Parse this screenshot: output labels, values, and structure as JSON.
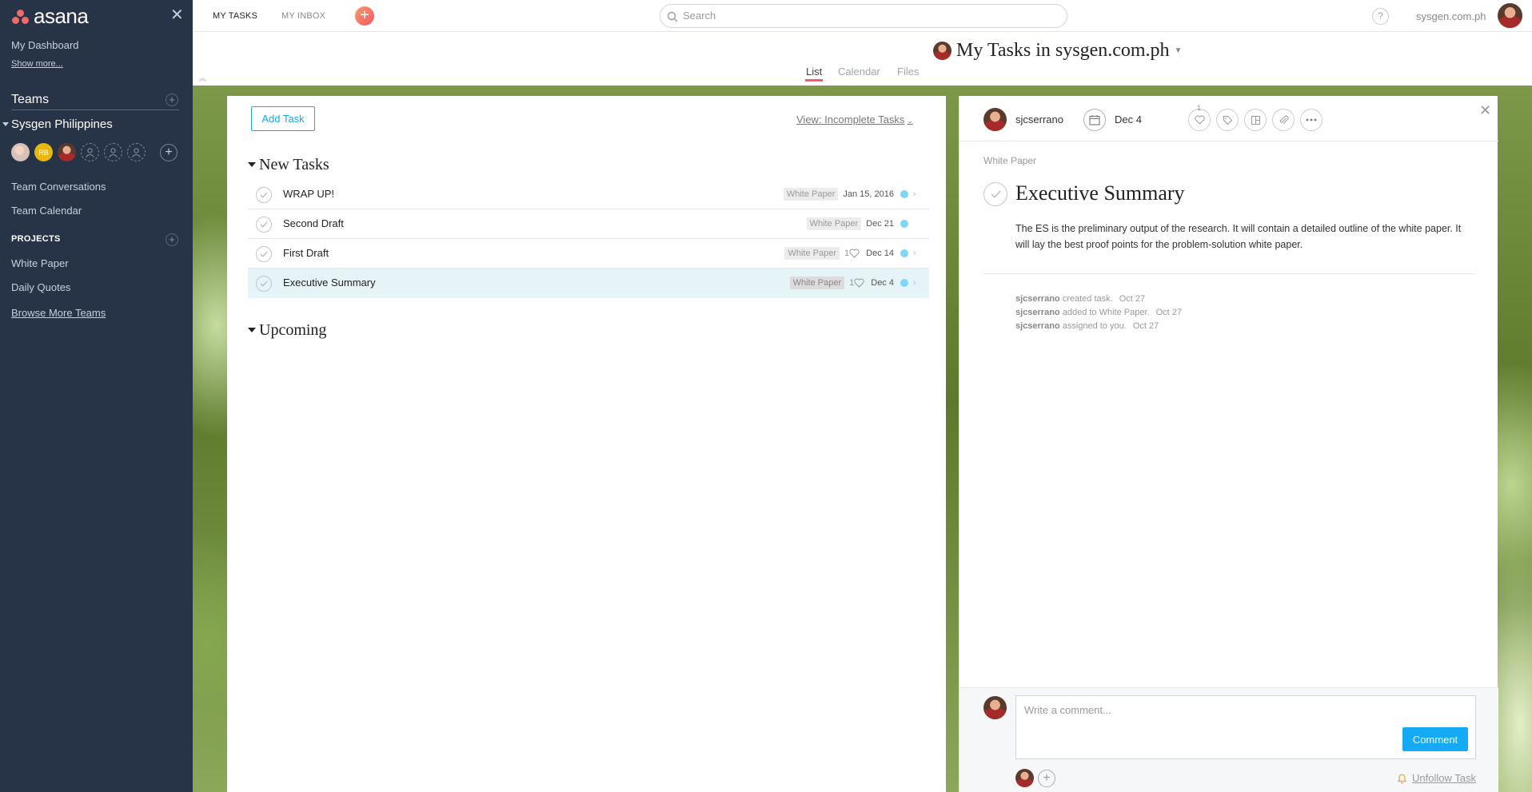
{
  "app": {
    "logo_text": "asana"
  },
  "sidebar": {
    "close_glyph": "✕",
    "dashboard_label": "My Dashboard",
    "show_more_label": "Show more...",
    "teams_label": "Teams",
    "team_name": "Sysgen Philippines",
    "member_initials": "RB",
    "team_conversations_label": "Team Conversations",
    "team_calendar_label": "Team Calendar",
    "projects_label": "PROJECTS",
    "projects": [
      {
        "label": "White Paper"
      },
      {
        "label": "Daily Quotes"
      }
    ],
    "browse_more_label": "Browse More Teams"
  },
  "topbar": {
    "my_tasks_label": "MY TASKS",
    "my_inbox_label": "MY INBOX",
    "search_placeholder": "Search",
    "help_label": "?",
    "workspace_name": "sysgen.com.ph"
  },
  "titlebar": {
    "title": "My Tasks in sysgen.com.ph",
    "views": [
      "List",
      "Calendar",
      "Files"
    ]
  },
  "list": {
    "add_task_label": "Add Task",
    "view_filter_label": "View: Incomplete Tasks",
    "sections": [
      {
        "name": "New Tasks",
        "tasks": [
          {
            "name": "WRAP UP!",
            "tag": "White Paper",
            "likes": "",
            "date": "Jan 15, 2016"
          },
          {
            "name": "Second Draft",
            "tag": "White Paper",
            "likes": "",
            "date": "Dec 21"
          },
          {
            "name": "First Draft",
            "tag": "White Paper",
            "likes": "1",
            "date": "Dec 14"
          },
          {
            "name": "Executive Summary",
            "tag": "White Paper",
            "likes": "1",
            "date": "Dec 4"
          }
        ]
      },
      {
        "name": "Upcoming",
        "tasks": []
      }
    ]
  },
  "detail": {
    "assignee": "sjcserrano",
    "due_date": "Dec 4",
    "like_count": "1",
    "project": "White Paper",
    "title": "Executive Summary",
    "description": "The ES is the preliminary output of the research. It will contain a detailed outline of the white paper. It will lay the best proof points for the problem-solution white paper.",
    "stories": [
      {
        "user": "sjcserrano",
        "action": "created task.",
        "when": "Oct 27"
      },
      {
        "user": "sjcserrano",
        "action": "added to White Paper.",
        "when": "Oct 27"
      },
      {
        "user": "sjcserrano",
        "action": "assigned to you.",
        "when": "Oct 27"
      }
    ],
    "comment_placeholder": "Write a comment...",
    "comment_button_label": "Comment",
    "unfollow_label": "Unfollow Task"
  },
  "colors": {
    "sidebar_bg": "#273347",
    "accent_blue": "#14aaf5",
    "accent_coral": "#f2596b",
    "due_dot": "#7ed8f5"
  }
}
